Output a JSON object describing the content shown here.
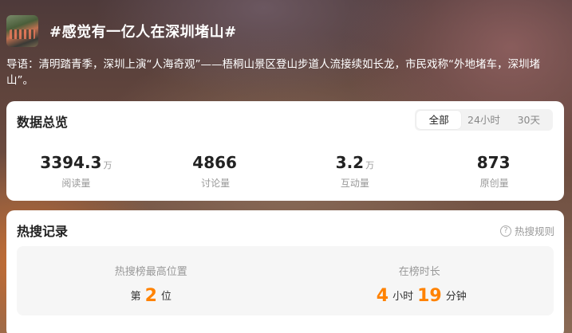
{
  "topic": {
    "title": "#感觉有一亿人在深圳堵山#",
    "lead": "导语：清明踏青季，深圳上演“人海奇观”——梧桐山景区登山步道人流接续如长龙，市民戏称“外地堵车，深圳堵山”。"
  },
  "overview": {
    "title": "数据总览",
    "tabs": [
      "全部",
      "24小时",
      "30天"
    ],
    "active_tab": "全部",
    "stats": [
      {
        "value": "3394.3",
        "unit": "万",
        "label": "阅读量"
      },
      {
        "value": "4866",
        "unit": "",
        "label": "讨论量"
      },
      {
        "value": "3.2",
        "unit": "万",
        "label": "互动量"
      },
      {
        "value": "873",
        "unit": "",
        "label": "原创量"
      }
    ]
  },
  "hot_record": {
    "title": "热搜记录",
    "rules_label": "热搜规则",
    "rules_icon": "question-icon",
    "highest_position_label": "热搜榜最高位置",
    "position_prefix": "第",
    "position_value": "2",
    "position_suffix": "位",
    "duration_label": "在榜时长",
    "hours_value": "4",
    "hours_unit": "小时",
    "minutes_value": "19",
    "minutes_unit": "分钟"
  },
  "colors": {
    "accent": "#ff8200",
    "card_bg": "#ffffff",
    "muted_text": "#999999"
  }
}
